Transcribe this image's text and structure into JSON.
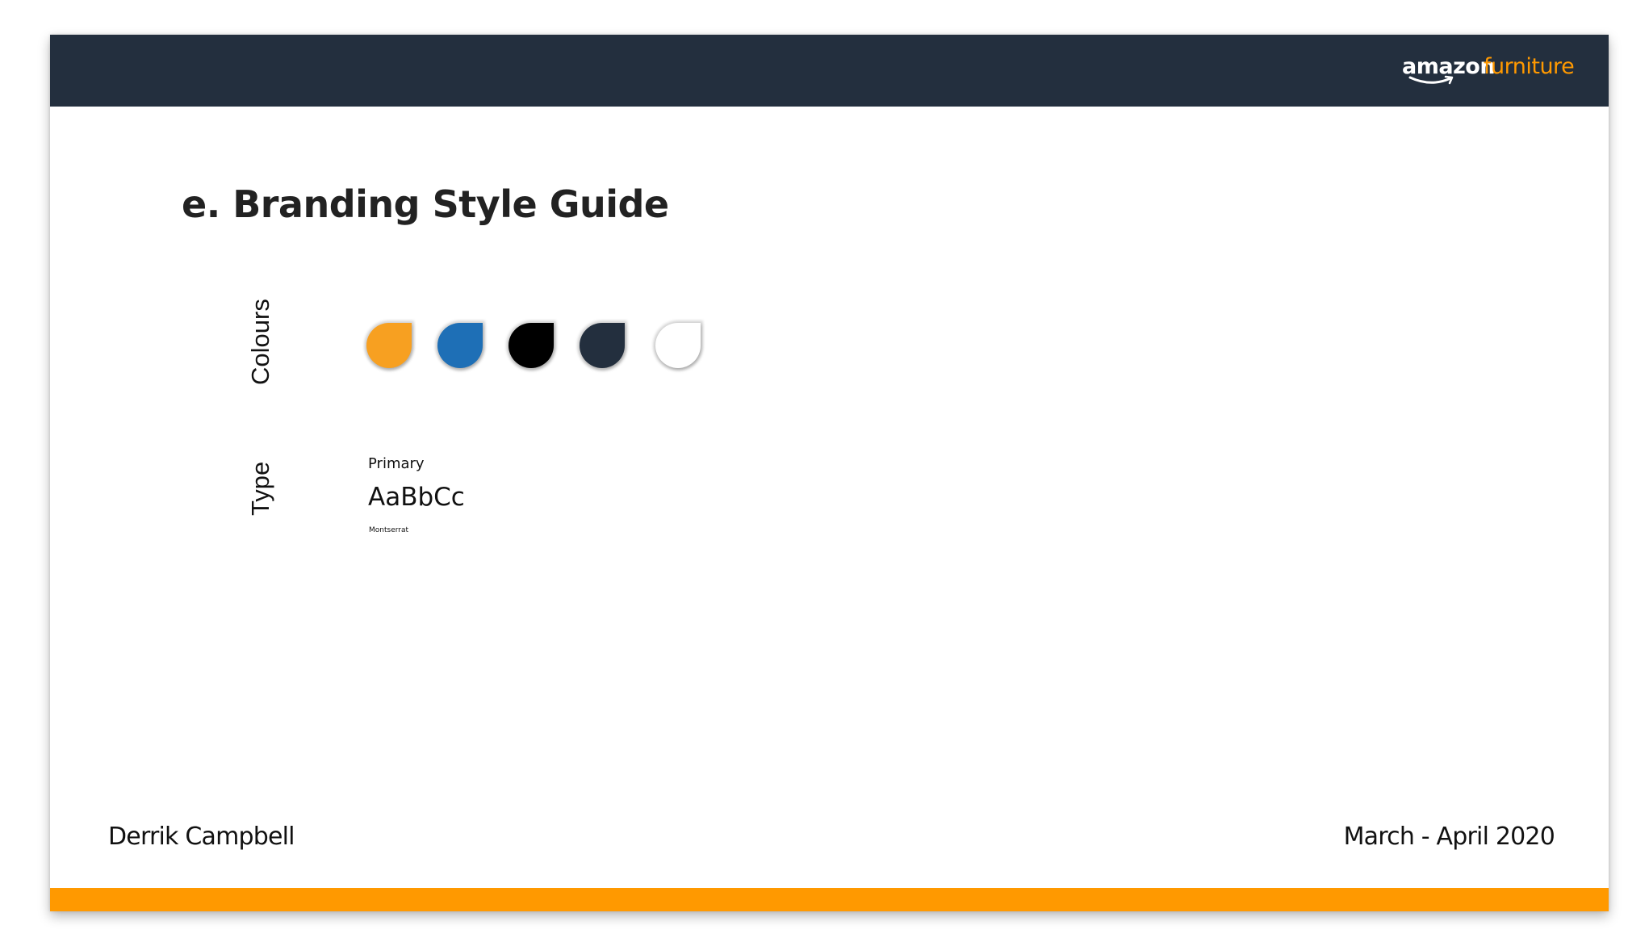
{
  "brand": {
    "logo_word_1": "amazon",
    "logo_word_2": "furniture",
    "header_color": "#232f3e",
    "accent_color": "#ff9900"
  },
  "slide": {
    "title": "e. Branding Style Guide"
  },
  "colours": {
    "label": "Colours",
    "swatches": [
      {
        "name": "orange",
        "hex": "#f7a021"
      },
      {
        "name": "blue",
        "hex": "#1e6fb6"
      },
      {
        "name": "black",
        "hex": "#000000"
      },
      {
        "name": "navy",
        "hex": "#232f3e"
      },
      {
        "name": "white",
        "hex": "#ffffff"
      }
    ]
  },
  "type": {
    "label": "Type",
    "primary_label": "Primary",
    "sample": "AaBbCc",
    "font_name": "Montserrat"
  },
  "footer": {
    "author": "Derrik Campbell",
    "date": "March - April 2020"
  }
}
